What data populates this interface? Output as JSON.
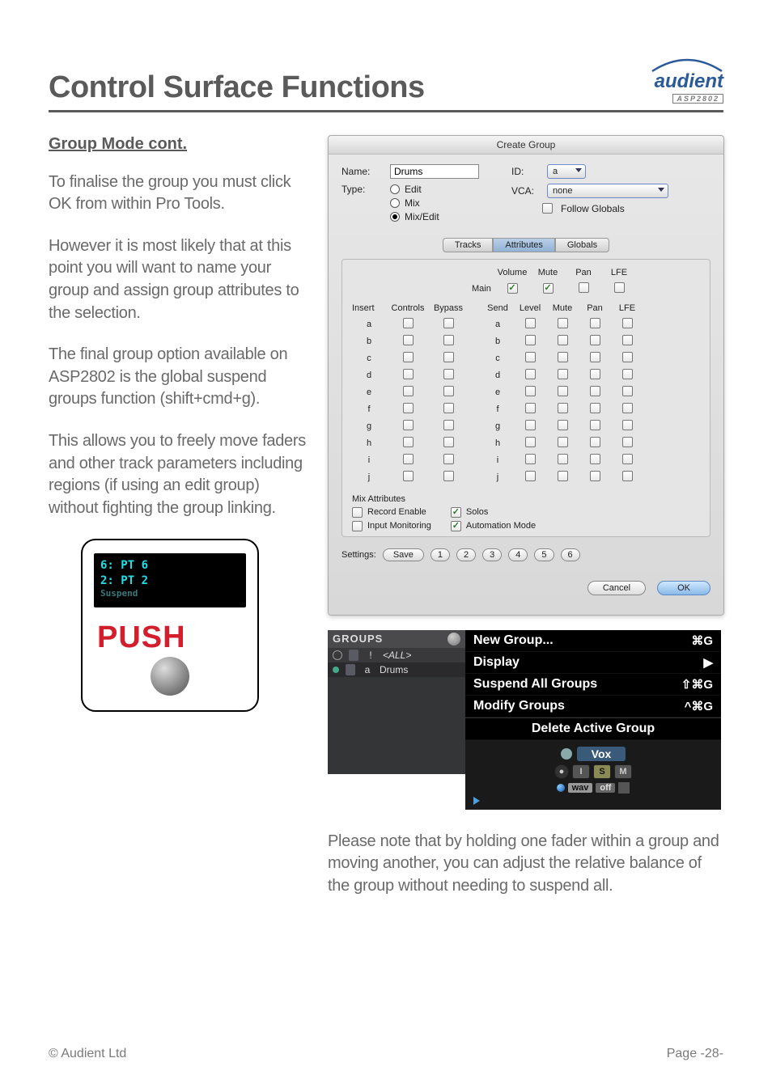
{
  "header": {
    "title": "Control Surface Functions",
    "brand": "audient",
    "model": "ASP2802"
  },
  "section_heading": "Group Mode cont.",
  "paragraphs": {
    "p1": "To finalise the group you must click OK from within Pro Tools.",
    "p2": "However it is most likely that at this point you will want to name your group and assign group attributes to the selection.",
    "p3": "The final group option available on ASP2802 is the global suspend groups function (shift+cmd+g).",
    "p4": "This allows you to freely move faders and other track parameters including regions (if using an edit group) without fighting the group linking."
  },
  "push_lcd": {
    "line1": "6: PT 6",
    "line2": "2: PT 2",
    "line3": "Suspend"
  },
  "push_label": "PUSH",
  "dialog": {
    "title": "Create Group",
    "name_label": "Name:",
    "name_value": "Drums",
    "type_label": "Type:",
    "types": {
      "edit": "Edit",
      "mix": "Mix",
      "mixedit": "Mix/Edit"
    },
    "id_label": "ID:",
    "id_value": "a",
    "vca_label": "VCA:",
    "vca_value": "none",
    "follow_globals": "Follow Globals",
    "tabs": {
      "tracks": "Tracks",
      "attributes": "Attributes",
      "globals": "Globals"
    },
    "top_cols": {
      "volume": "Volume",
      "mute": "Mute",
      "pan": "Pan",
      "lfe": "LFE"
    },
    "main_label": "Main",
    "insert_head": {
      "insert": "Insert",
      "controls": "Controls",
      "bypass": "Bypass"
    },
    "send_head": {
      "send": "Send",
      "level": "Level",
      "mute": "Mute",
      "pan": "Pan",
      "lfe": "LFE"
    },
    "rows": [
      "a",
      "b",
      "c",
      "d",
      "e",
      "f",
      "g",
      "h",
      "i",
      "j"
    ],
    "mix_attr_title": "Mix Attributes",
    "mix_attr": {
      "rec": "Record Enable",
      "inm": "Input Monitoring",
      "solos": "Solos",
      "automode": "Automation Mode"
    },
    "settings_label": "Settings:",
    "save": "Save",
    "presets": [
      "1",
      "2",
      "3",
      "4",
      "5",
      "6"
    ],
    "cancel": "Cancel",
    "ok": "OK"
  },
  "groups_panel": {
    "head": "GROUPS",
    "rows": [
      {
        "letter": "!",
        "name": "<ALL>"
      },
      {
        "letter": "a",
        "name": "Drums"
      }
    ]
  },
  "context_menu": {
    "new_group": "New Group...",
    "new_group_sc": "⌘G",
    "display": "Display",
    "suspend": "Suspend All Groups",
    "suspend_sc": "⇧⌘G",
    "modify": "Modify Groups",
    "modify_sc": "^⌘G",
    "delete": "Delete Active Group",
    "track_name": "Vox",
    "i": "I",
    "s": "S",
    "m": "M",
    "wav": "wav",
    "off": "off"
  },
  "bottom_note": "Please note that by holding one fader within a group and moving another, you can adjust the relative balance of the group without needing to suspend all.",
  "footer": {
    "left": "© Audient Ltd",
    "right": "Page -28-"
  }
}
